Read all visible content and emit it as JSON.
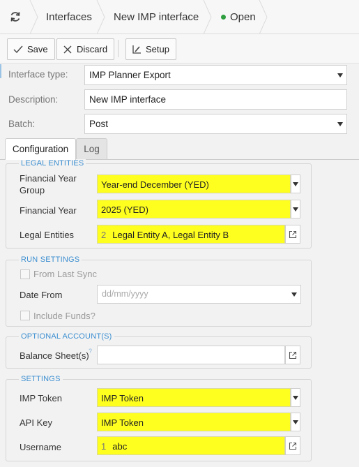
{
  "breadcrumb": {
    "items": [
      "Interfaces",
      "New IMP interface"
    ],
    "status": "Open",
    "status_color": "#2e9e3e"
  },
  "toolbar": {
    "save_label": "Save",
    "discard_label": "Discard",
    "setup_label": "Setup"
  },
  "form": {
    "interface_type": {
      "label": "Interface type:",
      "value": "IMP Planner Export"
    },
    "description": {
      "label": "Description:",
      "value": "New IMP interface"
    },
    "batch": {
      "label": "Batch:",
      "value": "Post"
    }
  },
  "tabs": [
    {
      "label": "Configuration",
      "active": true
    },
    {
      "label": "Log",
      "active": false
    }
  ],
  "legal_entities": {
    "title": "LEGAL ENTITIES",
    "fy_group": {
      "label": "Financial Year Group",
      "value": "Year-end December (YED)"
    },
    "fy": {
      "label": "Financial Year",
      "value": "2025 (YED)"
    },
    "entities": {
      "label": "Legal Entities",
      "count": "2",
      "value": "Legal Entity A, Legal Entity B"
    }
  },
  "run_settings": {
    "title": "RUN SETTINGS",
    "from_last_sync": "From Last Sync",
    "date_from": {
      "label": "Date From",
      "placeholder": "dd/mm/yyyy"
    },
    "include_funds": "Include Funds?"
  },
  "optional_accounts": {
    "title": "OPTIONAL ACCOUNT(S)",
    "balance_sheets": {
      "label": "Balance Sheet(s)",
      "help": "?",
      "value": ""
    }
  },
  "settings": {
    "title": "SETTINGS",
    "imp_token": {
      "label": "IMP Token",
      "value": "IMP Token"
    },
    "api_key": {
      "label": "API Key",
      "value": "IMP Token"
    },
    "username": {
      "label": "Username",
      "count": "1",
      "value": "abc"
    }
  },
  "colors": {
    "highlight": "#ffff1f",
    "accent": "#3d8fd1"
  }
}
